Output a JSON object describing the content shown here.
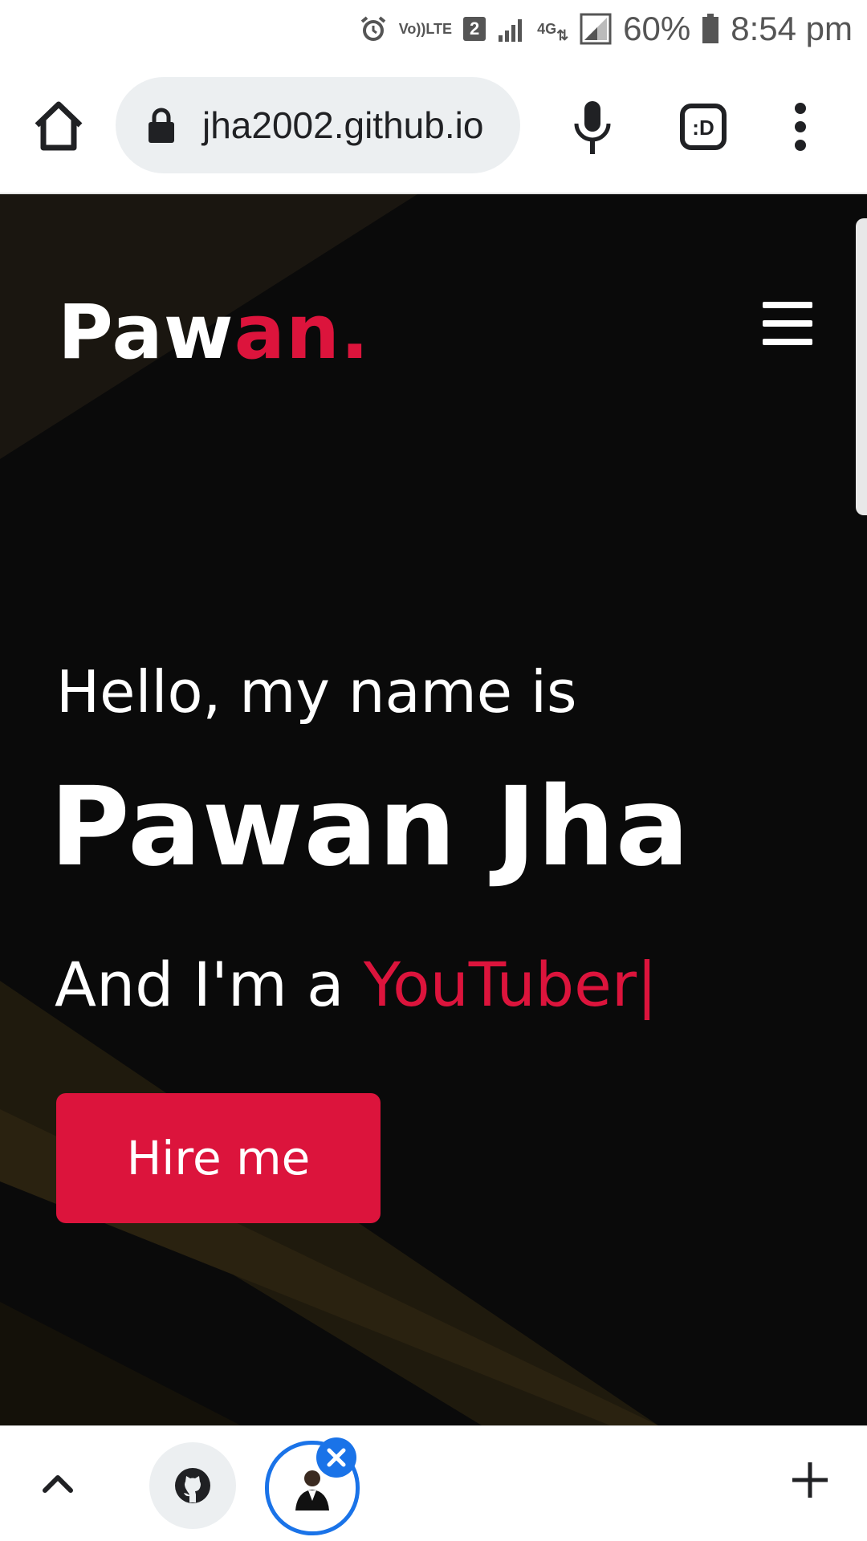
{
  "status_bar": {
    "alarm_icon": "alarm-clock-icon",
    "volte_line1": "Vo))",
    "volte_line2": "LTE",
    "sim_slot": "2",
    "network_4g": "4G",
    "battery_percent": "60%",
    "time": "8:54 pm"
  },
  "browser": {
    "url": "jha2002.github.io",
    "tab_switcher_label": ":D",
    "tabs": [
      {
        "icon": "github-icon"
      },
      {
        "icon": "profile-photo-icon",
        "active": true
      }
    ]
  },
  "site": {
    "logo_main": "Paw",
    "logo_accent": "an.",
    "greeting": "Hello, my name is",
    "name": "Pawan Jha",
    "role_prefix": "And I'm a ",
    "role_typed": "YouTuber",
    "role_cursor": "|",
    "hire_button": "Hire me"
  },
  "colors": {
    "accent": "#dc143c",
    "background": "#0a0a0a",
    "active_tab_ring": "#1a73e8"
  }
}
